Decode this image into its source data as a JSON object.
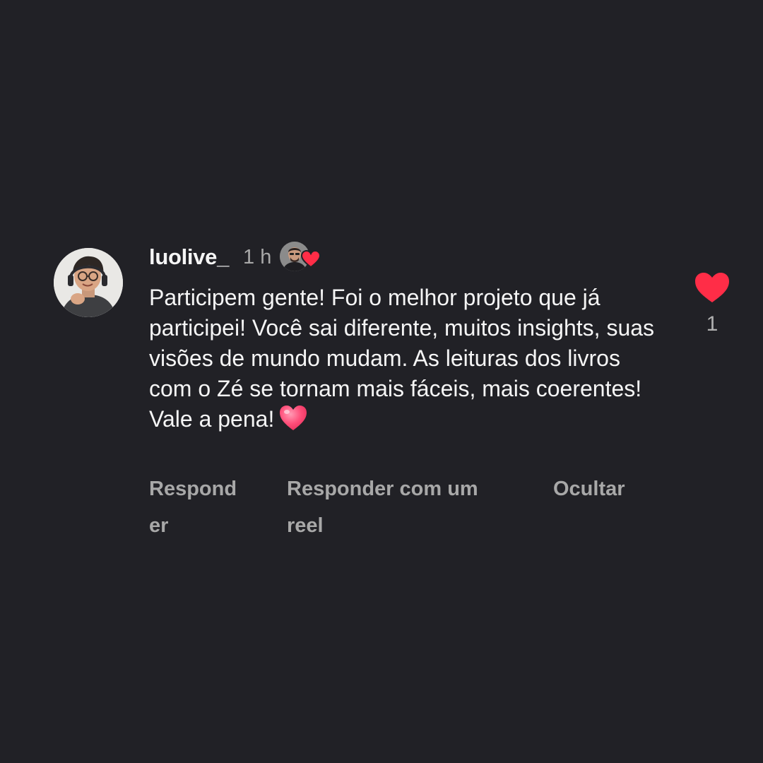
{
  "comment": {
    "username": "luolive_",
    "time": "1 h",
    "text": "Participem gente! Foi o melhor projeto que já participei! Você sai diferente, muitos insights, suas visões de mundo mudam. As leituras dos livros com o Zé se tornam mais fáceis, mais coerentes! Vale a pena!",
    "trailing_emoji": "pink-heart-icon",
    "creator_liked": true,
    "actions": {
      "reply": "Responder",
      "reply_reel": "Responder com um reel",
      "hide": "Ocultar"
    },
    "likes": {
      "count": "1",
      "liked": true,
      "icon": "heart-icon"
    }
  },
  "colors": {
    "background": "#212126",
    "primary_text": "#f5f5f5",
    "secondary_text": "#a8a8a8",
    "like_red": "#ff2d47",
    "emoji_pink": "#ff4f7a"
  }
}
